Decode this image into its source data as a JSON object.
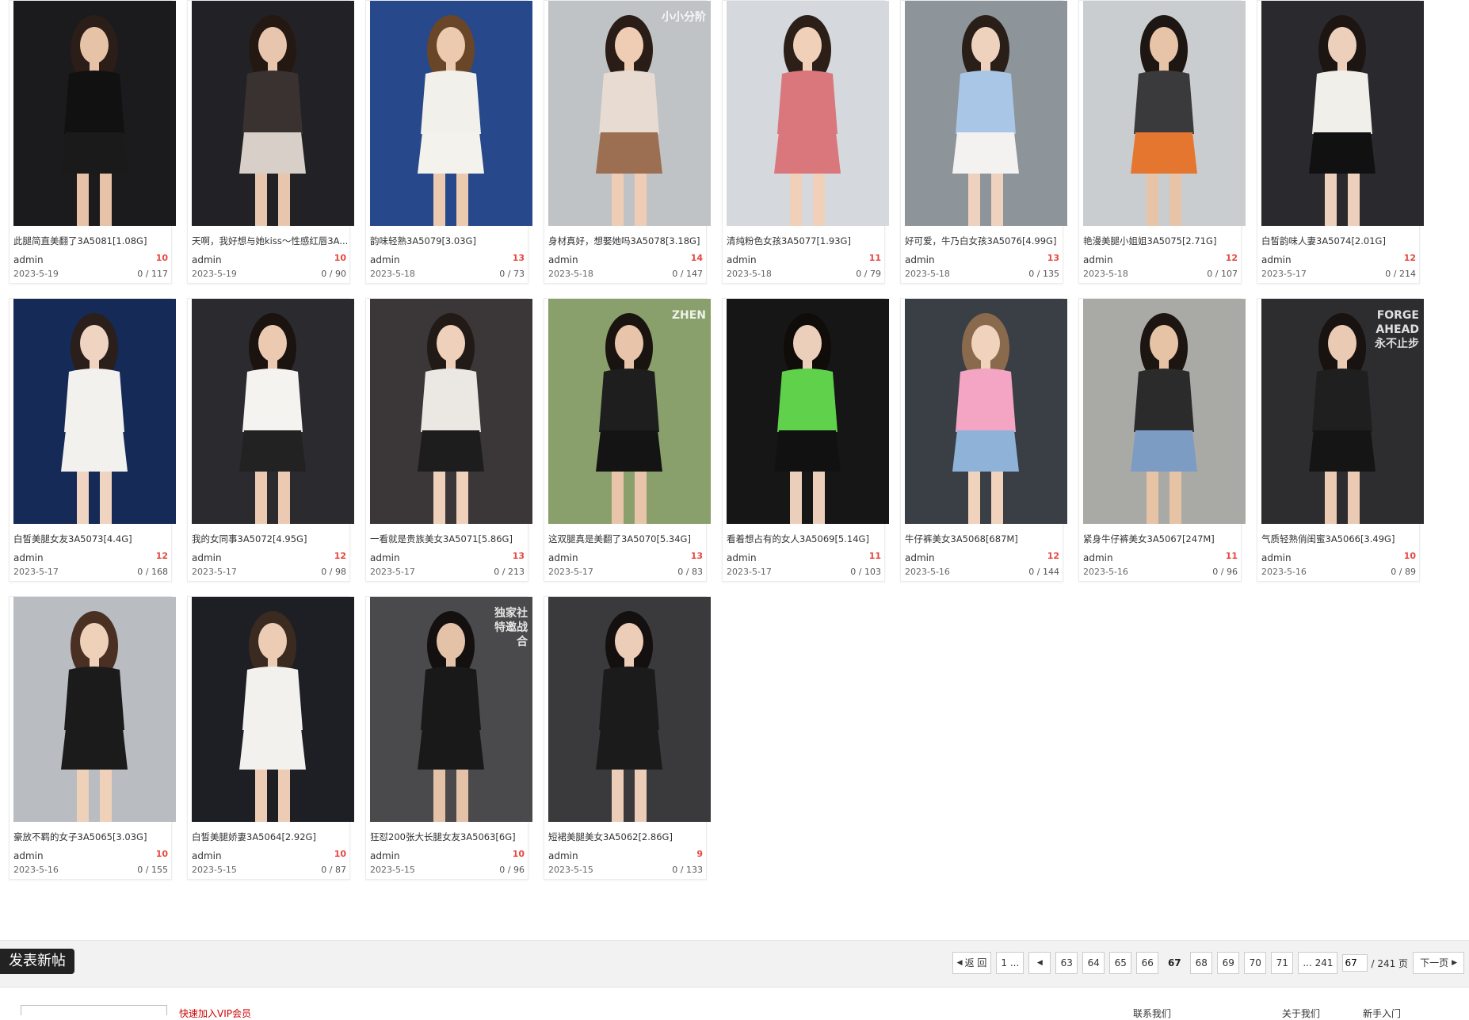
{
  "posts": [
    {
      "title": "此腿简直美翻了3A5081[1.08G]",
      "author": "admin",
      "date": "2023-5-19",
      "replies": "10",
      "views": "0 / 117",
      "bg": "#1b1b1e",
      "top": "#111111",
      "bottom": "#1a1a1a",
      "skin": "#e6c2a6",
      "hair": "#2b1d17"
    },
    {
      "title": "天啊，我好想与她kiss～性感红唇3A...",
      "author": "admin",
      "date": "2023-5-19",
      "replies": "10",
      "views": "0 / 90",
      "bg": "#222226",
      "top": "#3a3230",
      "bottom": "#d8d0c8",
      "skin": "#e8c6ad",
      "hair": "#241812"
    },
    {
      "title": "韵味轻熟3A5079[3.03G]",
      "author": "admin",
      "date": "2023-5-18",
      "replies": "13",
      "views": "0 / 73",
      "bg": "#27488a",
      "top": "#f2f0ea",
      "bottom": "#f4f2ec",
      "skin": "#eccab0",
      "hair": "#6a4628"
    },
    {
      "title": "身材真好，想娶她吗3A5078[3.18G]",
      "author": "admin",
      "date": "2023-5-18",
      "replies": "14",
      "views": "0 / 147",
      "bg": "#bfc3c6",
      "top": "#e8dbd2",
      "bottom": "#9c6f52",
      "skin": "#efcdb5",
      "hair": "#2a1c16"
    },
    {
      "title": "清纯粉色女孩3A5077[1.93G]",
      "author": "admin",
      "date": "2023-5-18",
      "replies": "11",
      "views": "0 / 79",
      "bg": "#d5d8dc",
      "top": "#d9777c",
      "bottom": "#d9777c",
      "skin": "#f0d0b8",
      "hair": "#2c1f18"
    },
    {
      "title": "好可爱，牛乃白女孩3A5076[4.99G]",
      "author": "admin",
      "date": "2023-5-18",
      "replies": "13",
      "views": "0 / 135",
      "bg": "#8d949a",
      "top": "#a9c6e6",
      "bottom": "#f3f2f0",
      "skin": "#efd2be",
      "hair": "#2a1e19"
    },
    {
      "title": "艳漫美腿小姐姐3A5075[2.71G]",
      "author": "admin",
      "date": "2023-5-18",
      "replies": "12",
      "views": "0 / 107",
      "bg": "#c9cdd0",
      "top": "#3a3a3c",
      "bottom": "#e5762f",
      "skin": "#e7c4a8",
      "hair": "#1e1612"
    },
    {
      "title": "白皙韵味人妻3A5074[2.01G]",
      "author": "admin",
      "date": "2023-5-17",
      "replies": "12",
      "views": "0 / 214",
      "bg": "#2a2a2e",
      "top": "#f1efea",
      "bottom": "#111111",
      "skin": "#edd0bb",
      "hair": "#1c1512"
    },
    {
      "title": "白皙美腿女友3A5073[4.4G]",
      "author": "admin",
      "date": "2023-5-17",
      "replies": "12",
      "views": "0 / 168",
      "bg": "#152a56",
      "top": "#f2f1ee",
      "bottom": "#f2f1ee",
      "skin": "#f0d4c2",
      "hair": "#2a1f1a"
    },
    {
      "title": "我的女同事3A5072[4.95G]",
      "author": "admin",
      "date": "2023-5-17",
      "replies": "12",
      "views": "0 / 98",
      "bg": "#2b2b2f",
      "top": "#f4f3ef",
      "bottom": "#222222",
      "skin": "#ecc9b1",
      "hair": "#1a1310"
    },
    {
      "title": "一看就是贵族美女3A5071[5.86G]",
      "author": "admin",
      "date": "2023-5-17",
      "replies": "13",
      "views": "0 / 213",
      "bg": "#3b3638",
      "top": "#ebe8e3",
      "bottom": "#1d1d1d",
      "skin": "#efd0bb",
      "hair": "#221a16"
    },
    {
      "title": "这双腿真是美翻了3A5070[5.34G]",
      "author": "admin",
      "date": "2023-5-17",
      "replies": "13",
      "views": "0 / 83",
      "bg": "#8aa06c",
      "top": "#1e1e1e",
      "bottom": "#141414",
      "skin": "#e8c5aa",
      "hair": "#1a1410"
    },
    {
      "title": "看着想占有的女人3A5069[5.14G]",
      "author": "admin",
      "date": "2023-5-17",
      "replies": "11",
      "views": "0 / 103",
      "bg": "#161616",
      "top": "#5fd14a",
      "bottom": "#111111",
      "skin": "#eccfba",
      "hair": "#100c0a"
    },
    {
      "title": "牛仔裤美女3A5068[687M]",
      "author": "admin",
      "date": "2023-5-16",
      "replies": "12",
      "views": "0 / 144",
      "bg": "#3a3f45",
      "top": "#f4a5c4",
      "bottom": "#8fb3d8",
      "skin": "#f0d2bd",
      "hair": "#8a6a4c"
    },
    {
      "title": "紧身牛仔裤美女3A5067[247M]",
      "author": "admin",
      "date": "2023-5-16",
      "replies": "11",
      "views": "0 / 96",
      "bg": "#a9aaa6",
      "top": "#2b2b2b",
      "bottom": "#7c9cc4",
      "skin": "#e7c3a6",
      "hair": "#1c1512"
    },
    {
      "title": "气质轻熟俏闺蜜3A5066[3.49G]",
      "author": "admin",
      "date": "2023-5-16",
      "replies": "10",
      "views": "0 / 89",
      "bg": "#2d2d30",
      "top": "#1f1f1f",
      "bottom": "#151515",
      "skin": "#eacab3",
      "hair": "#181210"
    },
    {
      "title": "豪放不羁的女子3A5065[3.03G]",
      "author": "admin",
      "date": "2023-5-16",
      "replies": "10",
      "views": "0 / 155",
      "bg": "#b9bcc0",
      "top": "#1b1b1b",
      "bottom": "#1b1b1b",
      "skin": "#efd0b9",
      "hair": "#4a3022"
    },
    {
      "title": "白皙美腿娇妻3A5064[2.92G]",
      "author": "admin",
      "date": "2023-5-15",
      "replies": "10",
      "views": "0 / 87",
      "bg": "#1e1f24",
      "top": "#f2f1ee",
      "bottom": "#f2f1ee",
      "skin": "#ecccb5",
      "hair": "#3b2a20"
    },
    {
      "title": "狂怼200张大长腿女友3A5063[6G]",
      "author": "admin",
      "date": "2023-5-15",
      "replies": "10",
      "views": "0 / 96",
      "bg": "#4a4a4c",
      "top": "#191919",
      "bottom": "#191919",
      "skin": "#e4c2a7",
      "hair": "#141010"
    },
    {
      "title": "短裙美腿美女3A5062[2.86G]",
      "author": "admin",
      "date": "2023-5-15",
      "replies": "9",
      "views": "0 / 133",
      "bg": "#3a3a3d",
      "top": "#1b1b1b",
      "bottom": "#1b1b1b",
      "skin": "#eccdb7",
      "hair": "#141010"
    }
  ],
  "thumb_overlays": {
    "post3": "小小分阶",
    "post11": "ZHEN",
    "post15": "FORGE AHEAD 永不止步",
    "post18": "独家社 特邀战 合"
  },
  "toolbar": {
    "new_post_label": "发表新帖"
  },
  "pager": {
    "back_label": "返 回",
    "first_label": "1 ...",
    "pages": [
      "63",
      "64",
      "65",
      "66",
      "67",
      "68",
      "69",
      "70",
      "71"
    ],
    "current": "67",
    "last_label": "... 241",
    "input_value": "67",
    "total_label": "/ 241 页",
    "next_label": "下一页"
  },
  "footer": {
    "link_text": "快速加入VIP会员",
    "right_text_1": "联系我们",
    "right_text_2": "关于我们",
    "right_text_3": "新手入门"
  },
  "colors": {
    "badge": "#e8483f",
    "button_bg": "#222222",
    "pager_bg": "#f2f2f2"
  }
}
